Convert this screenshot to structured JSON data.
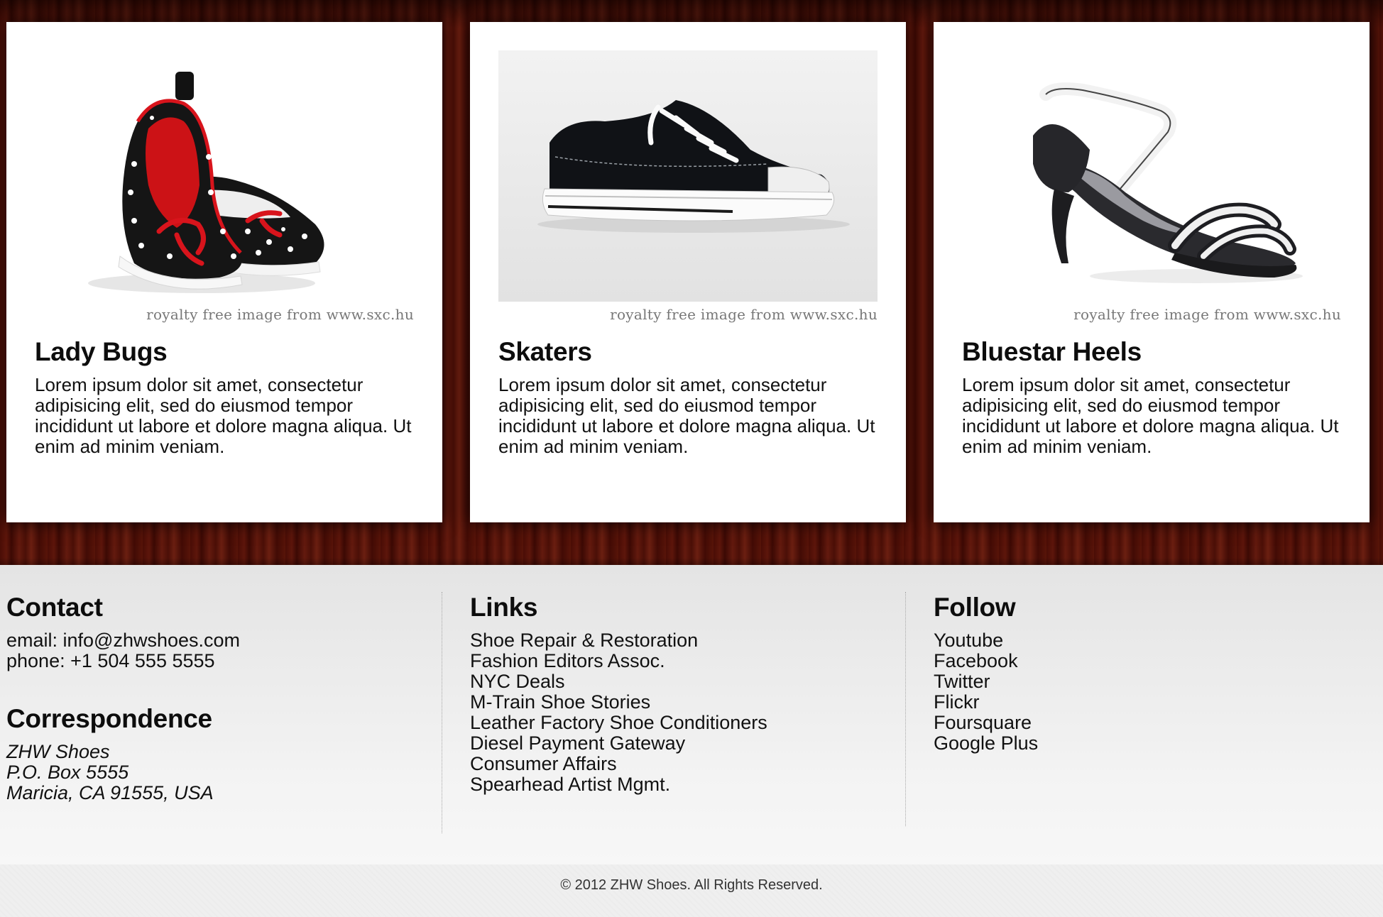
{
  "products": [
    {
      "title": "Lady Bugs",
      "image_icon": "polka-dot-flats-photo",
      "credit": "royalty free image from www.sxc.hu",
      "description": "Lorem ipsum dolor sit amet, consectetur adipisicing elit, sed do eiusmod tempor incididunt ut labore et dolore magna aliqua. Ut enim ad minim veniam."
    },
    {
      "title": "Skaters",
      "image_icon": "black-sneaker-photo",
      "credit": "royalty free image from www.sxc.hu",
      "description": "Lorem ipsum dolor sit amet, consectetur adipisicing elit, sed do eiusmod tempor incididunt ut labore et dolore magna aliqua. Ut enim ad minim veniam."
    },
    {
      "title": "Bluestar Heels",
      "image_icon": "strappy-heel-photo",
      "credit": "royalty free image from www.sxc.hu",
      "description": "Lorem ipsum dolor sit amet, consectetur adipisicing elit, sed do eiusmod tempor incididunt ut labore et dolore magna aliqua. Ut enim ad minim veniam."
    }
  ],
  "footer": {
    "contact": {
      "heading": "Contact",
      "email": "email: info@zhwshoes.com",
      "phone": "phone: +1 504 555 5555"
    },
    "correspondence": {
      "heading": "Correspondence",
      "lines": [
        "ZHW Shoes",
        "P.O. Box 5555",
        "Maricia, CA 91555, USA"
      ]
    },
    "links": {
      "heading": "Links",
      "items": [
        "Shoe Repair & Restoration",
        "Fashion Editors Assoc.",
        "NYC Deals",
        "M-Train Shoe Stories",
        "Leather Factory Shoe Conditioners",
        "Diesel Payment Gateway",
        "Consumer Affairs",
        "Spearhead Artist Mgmt."
      ]
    },
    "follow": {
      "heading": "Follow",
      "items": [
        "Youtube",
        "Facebook",
        "Twitter",
        "Flickr",
        "Foursquare",
        "Google Plus"
      ]
    }
  },
  "copyright": "© 2012 ZHW Shoes. All Rights Reserved.",
  "colors": {
    "wood": "#4d1008",
    "card": "#ffffff",
    "footer": "#e8e8e8",
    "sneaker_bg": "#f0f0f0"
  }
}
